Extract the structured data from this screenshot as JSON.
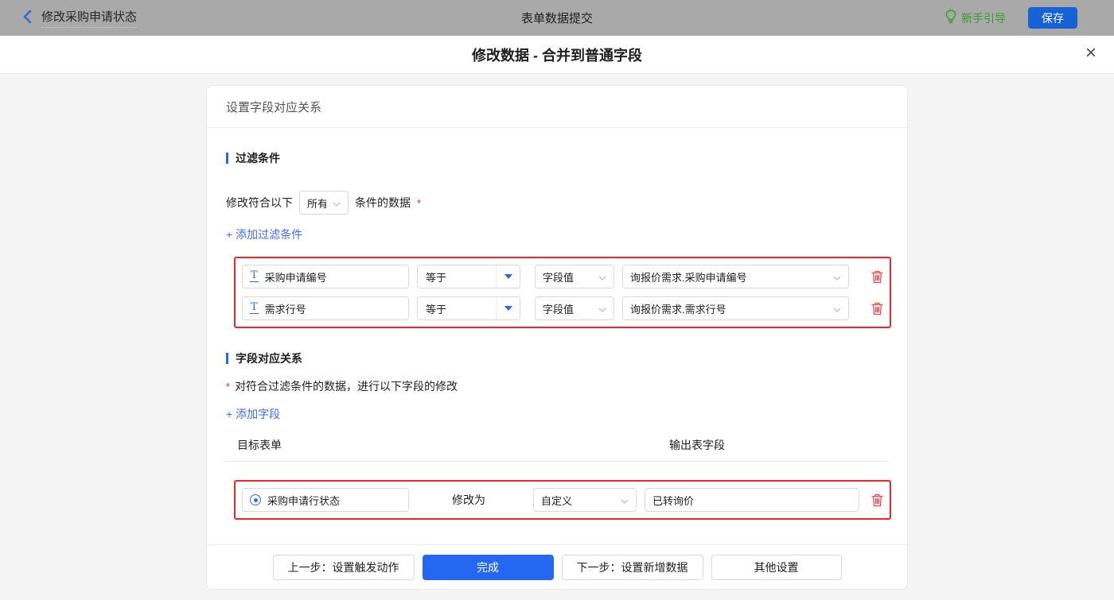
{
  "topbar": {
    "flow_title": "修改采购申请状态",
    "center_title": "表单数据提交",
    "guide_label": "新手引导",
    "save_label": "保存"
  },
  "dialog": {
    "title": "修改数据 - 合并到普通字段",
    "close_glyph": "×"
  },
  "panel": {
    "header": "设置字段对应关系",
    "filter_section": {
      "title": "过滤条件",
      "scope_prefix": "修改符合以下",
      "scope_value": "所有",
      "scope_suffix": "条件的数据",
      "required_mark": "*",
      "add_link": "+ 添加过滤条件",
      "rows": [
        {
          "field_icon": "T",
          "field": "采购申请编号",
          "operator": "等于",
          "value_type": "字段值",
          "value": "询报价需求.采购申请编号"
        },
        {
          "field_icon": "T",
          "field": "需求行号",
          "operator": "等于",
          "value_type": "字段值",
          "value": "询报价需求.需求行号"
        }
      ]
    },
    "mapping_section": {
      "title": "字段对应关系",
      "required_mark": "*",
      "description": "对符合过滤条件的数据，进行以下字段的修改",
      "add_link": "+ 添加字段",
      "col_target": "目标表单",
      "col_output": "输出表字段",
      "row": {
        "field": "采购申请行状态",
        "action_label": "修改为",
        "mode": "自定义",
        "value": "已转询价"
      }
    },
    "footer": {
      "prev_label": "上一步：设置触发动作",
      "done_label": "完成",
      "next_label": "下一步：设置新增数据",
      "other_label": "其他设置"
    }
  },
  "colors": {
    "accent_blue": "#2468f2",
    "link_blue": "#4569f0",
    "save_blue": "#1661d6",
    "guide_green": "#35a127",
    "highlight_red": "#f5222d",
    "topbar_gray": "#a9a9a9"
  }
}
